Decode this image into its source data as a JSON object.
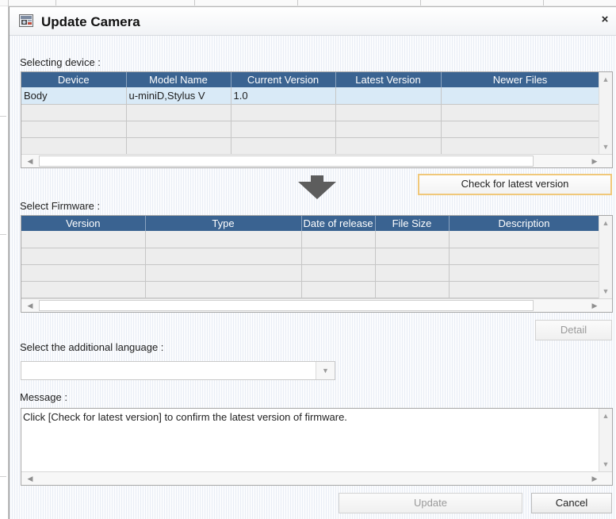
{
  "window": {
    "title": "Update Camera",
    "close_glyph": "×"
  },
  "device_section": {
    "label": "Selecting device :",
    "columns": [
      "Device",
      "Model Name",
      "Current Version",
      "Latest Version",
      "Newer Files"
    ],
    "rows": [
      [
        "Body",
        "u-miniD,Stylus V",
        "1.0",
        "",
        ""
      ],
      [
        "",
        "",
        "",
        "",
        ""
      ],
      [
        "",
        "",
        "",
        "",
        ""
      ],
      [
        "",
        "",
        "",
        "",
        ""
      ]
    ],
    "check_button_label": "Check for latest version"
  },
  "firmware_section": {
    "label": "Select Firmware :",
    "columns": [
      "Version",
      "Type",
      "Date of release",
      "File Size",
      "Description"
    ],
    "rows": [
      [
        "",
        "",
        "",
        "",
        ""
      ],
      [
        "",
        "",
        "",
        "",
        ""
      ],
      [
        "",
        "",
        "",
        "",
        ""
      ],
      [
        "",
        "",
        "",
        "",
        ""
      ]
    ],
    "detail_button_label": "Detail"
  },
  "language_section": {
    "label": "Select the additional language :",
    "selected_value": ""
  },
  "message_section": {
    "label": "Message :",
    "text": "Click [Check for latest version] to confirm the latest version of firmware."
  },
  "footer": {
    "update_label": "Update",
    "cancel_label": "Cancel"
  },
  "colors": {
    "header_bg": "#3a6391",
    "selected_row_bg": "#d9eaf7",
    "focus_border": "#f0c87a"
  },
  "icons": {
    "title": "camera-update-icon",
    "arrow": "down-arrow-icon"
  }
}
